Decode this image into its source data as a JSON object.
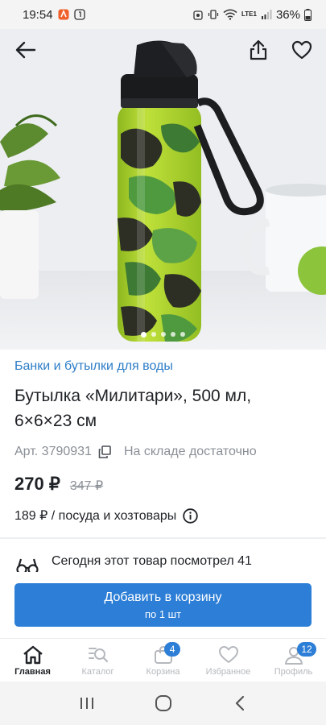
{
  "status_bar": {
    "time": "19:54",
    "battery": "36%",
    "network": "LTE1"
  },
  "product": {
    "category": "Банки и бутылки для воды",
    "title": "Бутылка «Милитари», 500 мл, 6×6×23 см",
    "article": "Арт. 3790931",
    "stock": "На складе достаточно",
    "price": "270 ₽",
    "old_price": "347 ₽",
    "unit_price_text": "189 ₽ / посуда и хозтовары",
    "watchers_text": "Сегодня этот товар посмотрел 41",
    "image_count": 5,
    "active_image": 0
  },
  "cart_button": {
    "label": "Добавить в корзину",
    "sublabel": "по 1 шт"
  },
  "bottom_nav": [
    {
      "label": "Главная",
      "icon": "home-icon",
      "active": true,
      "badge": ""
    },
    {
      "label": "Каталог",
      "icon": "catalog-search-icon",
      "active": false,
      "badge": ""
    },
    {
      "label": "Корзина",
      "icon": "cart-bag-icon",
      "active": false,
      "badge": "4"
    },
    {
      "label": "Избранное",
      "icon": "heart-icon",
      "active": false,
      "badge": ""
    },
    {
      "label": "Профиль",
      "icon": "profile-icon",
      "active": false,
      "badge": "12"
    }
  ],
  "colors": {
    "accent": "#2c7ed6",
    "category_link": "#2d7dc7",
    "muted": "#8a8f96"
  }
}
